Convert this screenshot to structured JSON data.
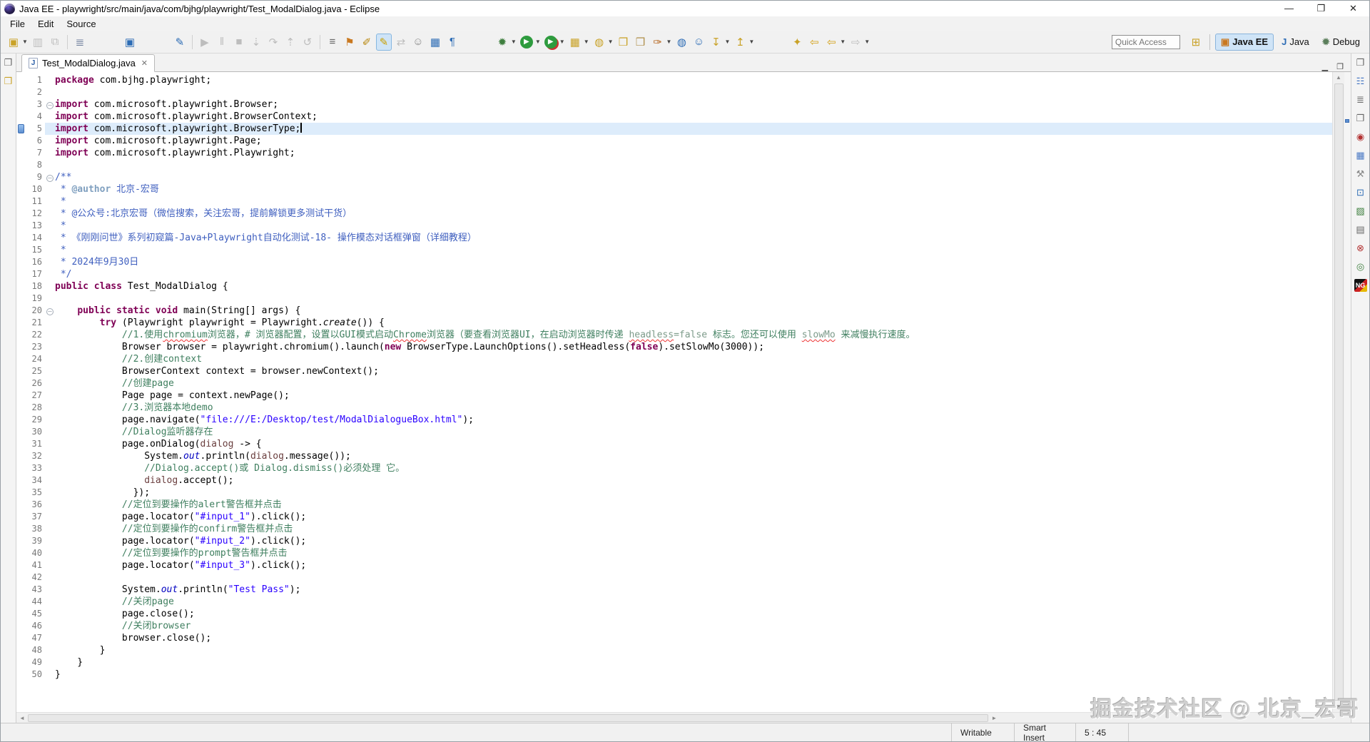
{
  "window": {
    "title": "Java EE - playwright/src/main/java/com/bjhg/playwright/Test_ModalDialog.java - Eclipse",
    "menu": [
      "File",
      "Edit",
      "Source"
    ],
    "controls": [
      {
        "name": "minimize-button",
        "glyph": "—"
      },
      {
        "name": "restore-button",
        "glyph": "❐"
      },
      {
        "name": "close-button",
        "glyph": "✕"
      }
    ]
  },
  "toolbar": {
    "quick_access_placeholder": "Quick Access",
    "items": [
      {
        "name": "new-button",
        "glyph": "▣",
        "color": "#c9a227",
        "dd": true
      },
      {
        "name": "save-button",
        "glyph": "▥",
        "disabled": true
      },
      {
        "name": "save-all-button",
        "glyph": "⧉",
        "disabled": true
      },
      {
        "sep": true
      },
      {
        "name": "tasks-page-button",
        "glyph": "≣",
        "color": "#6b7c9a"
      },
      {
        "gap": true
      },
      {
        "name": "console-view-button",
        "glyph": "▣",
        "color": "#2d6cb5"
      },
      {
        "gap": true
      },
      {
        "name": "annotation-pencil-button",
        "glyph": "✎",
        "color": "#2d6cb5"
      },
      {
        "sep": true
      },
      {
        "name": "resume-button",
        "glyph": "▶",
        "disabled": true
      },
      {
        "name": "suspend-button",
        "glyph": "‖",
        "disabled": true
      },
      {
        "name": "terminate-button",
        "glyph": "■",
        "disabled": true
      },
      {
        "name": "step-into-button",
        "glyph": "⇣",
        "disabled": true
      },
      {
        "name": "step-over-button",
        "glyph": "↷",
        "disabled": true
      },
      {
        "name": "step-return-button",
        "glyph": "⇡",
        "disabled": true
      },
      {
        "name": "drop-to-frame-button",
        "glyph": "↺",
        "disabled": true
      },
      {
        "sep": true
      },
      {
        "name": "show-source-button",
        "glyph": "≡",
        "color": "#666666"
      },
      {
        "name": "skip-breakpoints-button",
        "glyph": "⚑",
        "color": "#c9781f"
      },
      {
        "name": "last-edit-location-button",
        "glyph": "✐",
        "color": "#b8860b"
      },
      {
        "name": "mark-occurrences-button",
        "glyph": "✎",
        "color": "#caa002",
        "active": true
      },
      {
        "name": "link-with-editor-button",
        "glyph": "⇄",
        "disabled": true
      },
      {
        "name": "team-user-button",
        "glyph": "☺",
        "color": "#8a8a8a"
      },
      {
        "name": "table-view-button",
        "glyph": "▦",
        "color": "#2d6cb5"
      },
      {
        "name": "show-whitespace-button",
        "glyph": "¶",
        "color": "#2d6cb5"
      },
      {
        "gap": true
      },
      {
        "name": "debug-button",
        "glyph": "✹",
        "color": "#3f7f3f",
        "dd": true
      },
      {
        "name": "run-button",
        "glyph": "▶",
        "cls": "run-green",
        "dd": true
      },
      {
        "name": "coverage-button",
        "glyph": "▶",
        "cls": "cov-green",
        "dd": true
      },
      {
        "name": "new-server-toolbox-button",
        "glyph": "▦",
        "color": "#c9a227",
        "dd": true
      },
      {
        "name": "web-service-button",
        "glyph": "◍",
        "color": "#c9a227",
        "dd": true
      },
      {
        "name": "open-folder-button",
        "glyph": "❒",
        "color": "#c9a227"
      },
      {
        "name": "folder-button",
        "glyph": "❒",
        "color": "#b08f4a"
      },
      {
        "name": "format-brush-button",
        "glyph": "✑",
        "color": "#b5651d",
        "dd": true
      },
      {
        "name": "web-browser-button",
        "glyph": "◍",
        "color": "#2d6cb5"
      },
      {
        "name": "user-web-button",
        "glyph": "☺",
        "color": "#2d6cb5"
      },
      {
        "name": "import-button",
        "glyph": "↧",
        "color": "#c9a227",
        "dd": true
      },
      {
        "name": "export-button",
        "glyph": "↥",
        "color": "#c9a227",
        "dd": true
      },
      {
        "gap": true
      },
      {
        "name": "new-other-button",
        "glyph": "✦",
        "color": "#c9a227"
      },
      {
        "name": "back-button",
        "glyph": "⇦",
        "color": "#d4a017"
      },
      {
        "name": "back-history-button",
        "glyph": "⇦",
        "color": "#d4a017",
        "dd": true
      },
      {
        "name": "forward-button",
        "glyph": "⇨",
        "disabled": true,
        "dd": true
      }
    ],
    "perspectives": {
      "open_icon_glyph": "⊞",
      "buttons": [
        {
          "name": "perspective-java-ee",
          "label": "Java EE",
          "glyph": "▣",
          "glyph_color": "#c9781f",
          "active": true
        },
        {
          "name": "perspective-java",
          "label": "Java",
          "glyph": "J",
          "glyph_color": "#2d6cb5",
          "active": false
        },
        {
          "name": "perspective-debug",
          "label": "Debug",
          "glyph": "✹",
          "glyph_color": "#5b7e5b",
          "active": false
        }
      ]
    }
  },
  "left_rail": [
    {
      "name": "restore-view-icon",
      "glyph": "❐",
      "color": "#666666"
    },
    {
      "name": "package-explorer-icon",
      "glyph": "❒",
      "color": "#c9a227"
    }
  ],
  "right_rail": [
    {
      "name": "restore-view-icon",
      "glyph": "❐",
      "color": "#666666"
    },
    {
      "name": "outline-icon",
      "glyph": "☷",
      "color": "#4a79c4"
    },
    {
      "name": "tasks-icon",
      "glyph": "≣",
      "color": "#666666"
    },
    {
      "name": "restore-view-2-icon",
      "glyph": "❐",
      "color": "#666666"
    },
    {
      "name": "servers-icon",
      "glyph": "◉",
      "color": "#b33333"
    },
    {
      "name": "data-source-explorer-icon",
      "glyph": "▦",
      "color": "#4a79c4"
    },
    {
      "name": "snippets-icon",
      "glyph": "⚒",
      "color": "#888888"
    },
    {
      "name": "console-icon",
      "glyph": "⊡",
      "color": "#2d6cb5"
    },
    {
      "name": "palette-icon",
      "glyph": "▨",
      "color": "#3f7f3f"
    },
    {
      "name": "properties-icon",
      "glyph": "▤",
      "color": "#666666"
    },
    {
      "name": "problems-icon",
      "glyph": "⊗",
      "color": "#b33333"
    },
    {
      "name": "green-nodes-icon",
      "glyph": "◎",
      "color": "#3f7f3f"
    },
    {
      "name": "testng-icon",
      "glyph": "NG",
      "cls": "testng"
    }
  ],
  "tab": {
    "label": "Test_ModalDialog.java",
    "file_icon_letter": "J",
    "close_glyph": "✕"
  },
  "editor_controls": [
    {
      "name": "minimize-view-button",
      "glyph": "▁"
    },
    {
      "name": "maximize-view-button",
      "glyph": "❐"
    }
  ],
  "scrollbars": {
    "up": "▲",
    "down": "▼",
    "left": "◄",
    "right": "►"
  },
  "editor": {
    "current_line": 5,
    "cursor_line": 5,
    "fold_glyph": "–",
    "lines": [
      {
        "n": 1,
        "seg": [
          [
            "k",
            "package"
          ],
          [
            "p",
            " com.bjhg.playwright;"
          ]
        ]
      },
      {
        "n": 2,
        "seg": []
      },
      {
        "n": 3,
        "fold": true,
        "seg": [
          [
            "k",
            "import"
          ],
          [
            "p",
            " com.microsoft.playwright.Browser;"
          ]
        ]
      },
      {
        "n": 4,
        "seg": [
          [
            "k",
            "import"
          ],
          [
            "p",
            " com.microsoft.playwright.BrowserContext;"
          ]
        ]
      },
      {
        "n": 5,
        "seg": [
          [
            "k",
            "import"
          ],
          [
            "p",
            " com.microsoft.playwright.BrowserType;"
          ]
        ]
      },
      {
        "n": 6,
        "seg": [
          [
            "k",
            "import"
          ],
          [
            "p",
            " com.microsoft.playwright.Page;"
          ]
        ]
      },
      {
        "n": 7,
        "seg": [
          [
            "k",
            "import"
          ],
          [
            "p",
            " com.microsoft.playwright.Playwright;"
          ]
        ]
      },
      {
        "n": 8,
        "seg": []
      },
      {
        "n": 9,
        "fold": true,
        "seg": [
          [
            "j",
            "/**"
          ]
        ]
      },
      {
        "n": 10,
        "seg": [
          [
            "j",
            " * "
          ],
          [
            "jt",
            "@author"
          ],
          [
            "j",
            " 北京-宏哥"
          ]
        ]
      },
      {
        "n": 11,
        "seg": [
          [
            "j",
            " *"
          ]
        ]
      },
      {
        "n": 12,
        "seg": [
          [
            "j",
            " * @公众号:北京宏哥（微信搜索，关注宏哥，提前解锁更多测试干货）"
          ]
        ]
      },
      {
        "n": 13,
        "seg": [
          [
            "j",
            " *"
          ]
        ]
      },
      {
        "n": 14,
        "seg": [
          [
            "j",
            " * 《刚刚问世》系列初窥篇-Java+Playwright自动化测试-18- 操作模态对话框弹窗（详细教程）"
          ]
        ]
      },
      {
        "n": 15,
        "seg": [
          [
            "j",
            " *"
          ]
        ]
      },
      {
        "n": 16,
        "seg": [
          [
            "j",
            " * 2024年9月30日"
          ]
        ]
      },
      {
        "n": 17,
        "seg": [
          [
            "j",
            " */"
          ]
        ]
      },
      {
        "n": 18,
        "seg": [
          [
            "k",
            "public"
          ],
          [
            "p",
            " "
          ],
          [
            "k",
            "class"
          ],
          [
            "p",
            " Test_ModalDialog {"
          ]
        ]
      },
      {
        "n": 19,
        "seg": []
      },
      {
        "n": 20,
        "fold": true,
        "seg": [
          [
            "p",
            "    "
          ],
          [
            "k",
            "public"
          ],
          [
            "p",
            " "
          ],
          [
            "k",
            "static"
          ],
          [
            "p",
            " "
          ],
          [
            "k",
            "void"
          ],
          [
            "p",
            " main(String[] args) {"
          ]
        ]
      },
      {
        "n": 21,
        "seg": [
          [
            "p",
            "        "
          ],
          [
            "k",
            "try"
          ],
          [
            "p",
            " (Playwright playwright = Playwright."
          ],
          [
            "i",
            "create"
          ],
          [
            "p",
            "()) {"
          ]
        ]
      },
      {
        "n": 22,
        "seg": [
          [
            "p",
            "            "
          ],
          [
            "c",
            "//1.使用"
          ],
          [
            "cu",
            "chromium"
          ],
          [
            "c",
            "浏览器，# 浏览器配置，设置以GUI模式启动"
          ],
          [
            "cu",
            "Chrome"
          ],
          [
            "c",
            "浏览器（要查看浏览器UI，在启动浏览器时传递 "
          ],
          [
            "cgu",
            "headless"
          ],
          [
            "cg",
            "=false"
          ],
          [
            "c",
            " 标志。您还可以使用 "
          ],
          [
            "cgu",
            "slowMo"
          ],
          [
            "c",
            " 来减慢执行速度。"
          ]
        ]
      },
      {
        "n": 23,
        "seg": [
          [
            "p",
            "            Browser browser = playwright.chromium().launch("
          ],
          [
            "k",
            "new"
          ],
          [
            "p",
            " BrowserType.LaunchOptions().setHeadless("
          ],
          [
            "k",
            "false"
          ],
          [
            "p",
            ").setSlowMo(3000));"
          ]
        ]
      },
      {
        "n": 24,
        "seg": [
          [
            "p",
            "            "
          ],
          [
            "c",
            "//2.创建context"
          ]
        ]
      },
      {
        "n": 25,
        "seg": [
          [
            "p",
            "            BrowserContext context = browser.newContext();"
          ]
        ]
      },
      {
        "n": 26,
        "seg": [
          [
            "p",
            "            "
          ],
          [
            "c",
            "//创建page"
          ]
        ]
      },
      {
        "n": 27,
        "seg": [
          [
            "p",
            "            Page page = context.newPage();"
          ]
        ]
      },
      {
        "n": 28,
        "seg": [
          [
            "p",
            "            "
          ],
          [
            "c",
            "//3.浏览器本地demo"
          ]
        ]
      },
      {
        "n": 29,
        "seg": [
          [
            "p",
            "            page.navigate("
          ],
          [
            "s",
            "\"file:///E:/Desktop/test/ModalDialogueBox.html\""
          ],
          [
            "p",
            ");"
          ]
        ]
      },
      {
        "n": 30,
        "seg": [
          [
            "p",
            "            "
          ],
          [
            "c",
            "//Dialog监听器存在"
          ]
        ]
      },
      {
        "n": 31,
        "seg": [
          [
            "p",
            "            page.onDialog("
          ],
          [
            "v",
            "dialog"
          ],
          [
            "p",
            " -> {"
          ]
        ]
      },
      {
        "n": 32,
        "seg": [
          [
            "p",
            "                System."
          ],
          [
            "sf",
            "out"
          ],
          [
            "p",
            ".println("
          ],
          [
            "v",
            "dialog"
          ],
          [
            "p",
            ".message());"
          ]
        ]
      },
      {
        "n": 33,
        "seg": [
          [
            "p",
            "                "
          ],
          [
            "c",
            "//Dialog.accept()或 Dialog.dismiss()必须处理 它。"
          ]
        ]
      },
      {
        "n": 34,
        "seg": [
          [
            "p",
            "                "
          ],
          [
            "v",
            "dialog"
          ],
          [
            "p",
            ".accept();"
          ]
        ]
      },
      {
        "n": 35,
        "seg": [
          [
            "p",
            "              });"
          ]
        ]
      },
      {
        "n": 36,
        "seg": [
          [
            "p",
            "            "
          ],
          [
            "c",
            "//定位到要操作的alert警告框并点击"
          ]
        ]
      },
      {
        "n": 37,
        "seg": [
          [
            "p",
            "            page.locator("
          ],
          [
            "s",
            "\"#input_1\""
          ],
          [
            "p",
            ").click();"
          ]
        ]
      },
      {
        "n": 38,
        "seg": [
          [
            "p",
            "            "
          ],
          [
            "c",
            "//定位到要操作的confirm警告框并点击"
          ]
        ]
      },
      {
        "n": 39,
        "seg": [
          [
            "p",
            "            page.locator("
          ],
          [
            "s",
            "\"#input_2\""
          ],
          [
            "p",
            ").click();"
          ]
        ]
      },
      {
        "n": 40,
        "seg": [
          [
            "p",
            "            "
          ],
          [
            "c",
            "//定位到要操作的prompt警告框并点击"
          ]
        ]
      },
      {
        "n": 41,
        "seg": [
          [
            "p",
            "            page.locator("
          ],
          [
            "s",
            "\"#input_3\""
          ],
          [
            "p",
            ").click();"
          ]
        ]
      },
      {
        "n": 42,
        "seg": []
      },
      {
        "n": 43,
        "seg": [
          [
            "p",
            "            System."
          ],
          [
            "sf",
            "out"
          ],
          [
            "p",
            ".println("
          ],
          [
            "s",
            "\"Test Pass\""
          ],
          [
            "p",
            ");"
          ]
        ]
      },
      {
        "n": 44,
        "seg": [
          [
            "p",
            "            "
          ],
          [
            "c",
            "//关闭page"
          ]
        ]
      },
      {
        "n": 45,
        "seg": [
          [
            "p",
            "            page.close();"
          ]
        ]
      },
      {
        "n": 46,
        "seg": [
          [
            "p",
            "            "
          ],
          [
            "c",
            "//关闭browser"
          ]
        ]
      },
      {
        "n": 47,
        "seg": [
          [
            "p",
            "            browser.close();"
          ]
        ]
      },
      {
        "n": 48,
        "seg": [
          [
            "p",
            "        }"
          ]
        ]
      },
      {
        "n": 49,
        "seg": [
          [
            "p",
            "    }"
          ]
        ]
      },
      {
        "n": 50,
        "seg": [
          [
            "p",
            "}"
          ]
        ]
      }
    ]
  },
  "status": {
    "writable": "Writable",
    "insert_mode": "Smart Insert",
    "position": "5 : 45"
  },
  "watermark": "掘金技术社区 @ 北京_宏哥"
}
